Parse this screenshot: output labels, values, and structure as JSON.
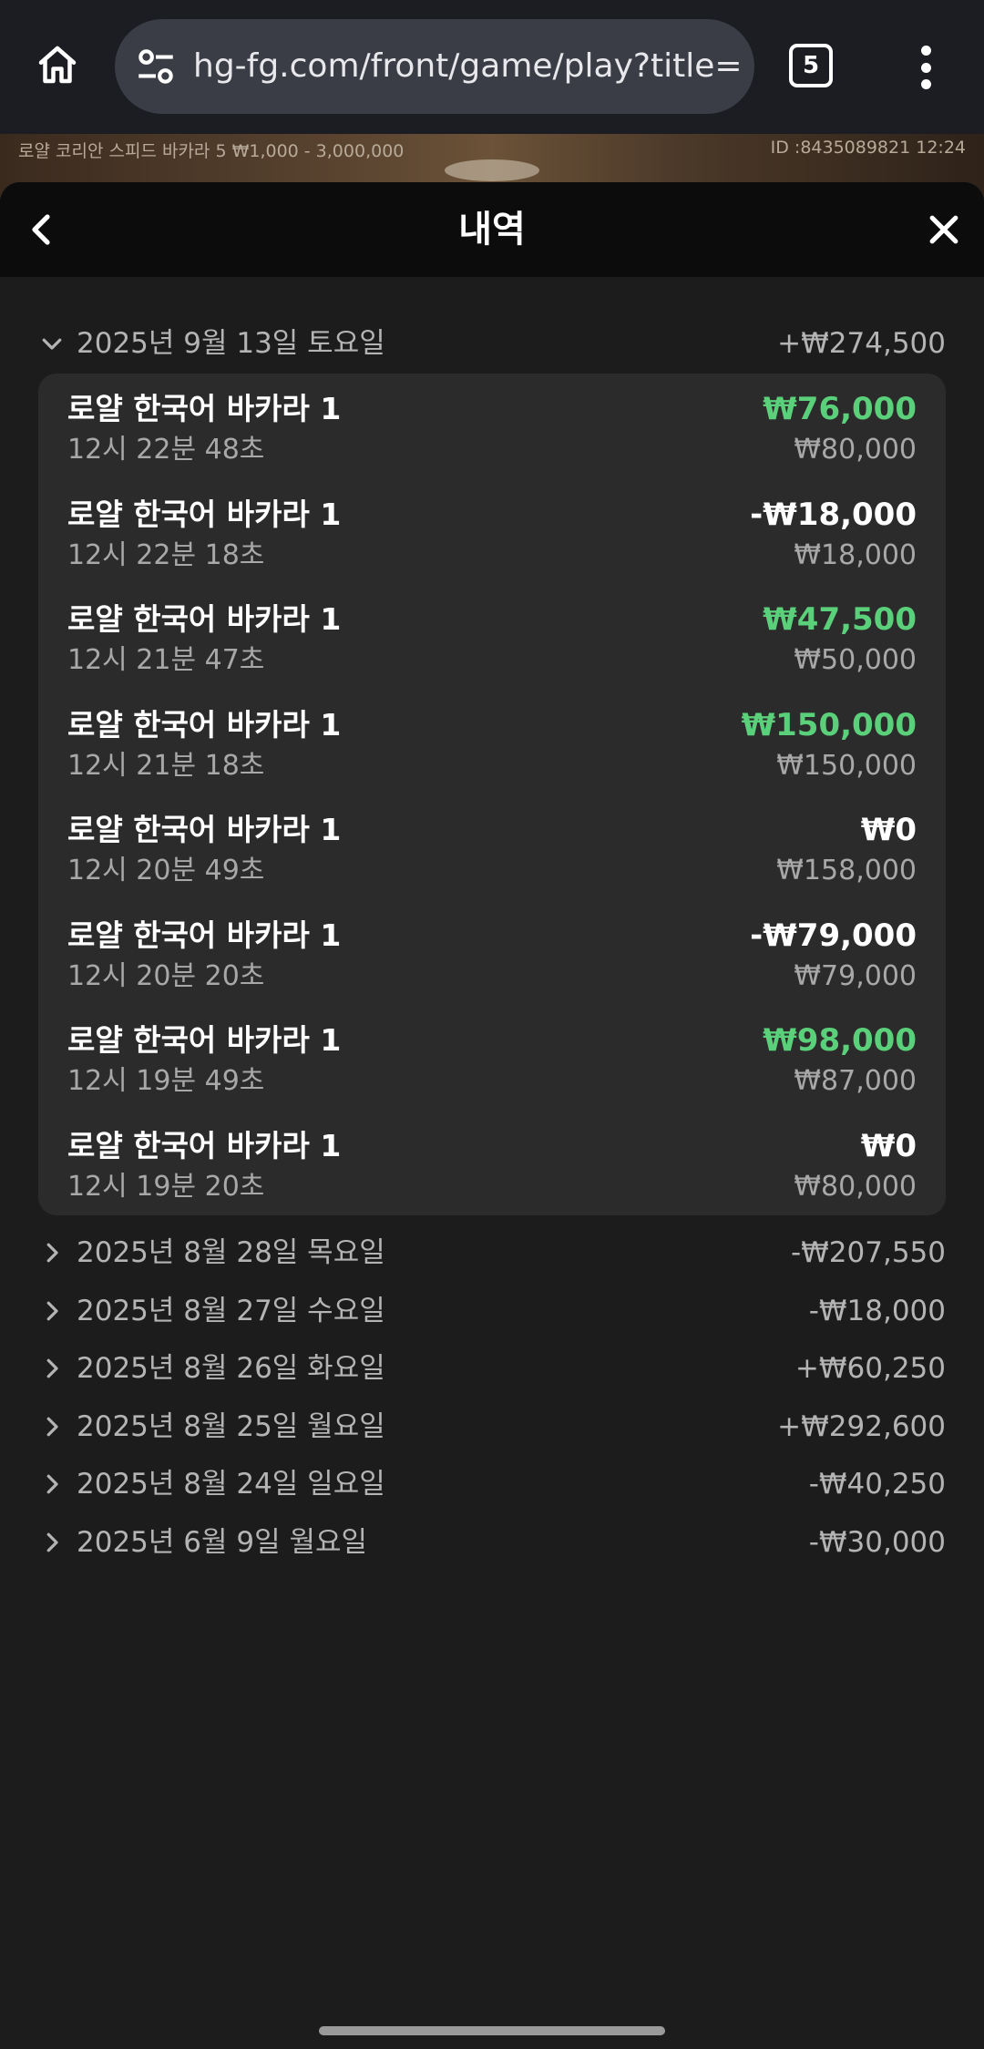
{
  "browser": {
    "url": "hg-fg.com/front/game/play?title=프",
    "tab_count": "5"
  },
  "game_strip": {
    "table_info": "로얄 코리안 스피드 바카라 5 ₩1,000 - 3,000,000",
    "round_info": "ID :8435089821 12:24"
  },
  "panel": {
    "title": "내역"
  },
  "expanded_day": {
    "date": "2025년 9월 13일 토요일",
    "total": "+₩274,500",
    "bets": [
      {
        "game": "로얄 한국어 바카라 1",
        "time": "12시 22분 48초",
        "result": "₩76,000",
        "stake": "₩80,000",
        "win": true
      },
      {
        "game": "로얄 한국어 바카라 1",
        "time": "12시 22분 18초",
        "result": "-₩18,000",
        "stake": "₩18,000",
        "win": false
      },
      {
        "game": "로얄 한국어 바카라 1",
        "time": "12시 21분 47초",
        "result": "₩47,500",
        "stake": "₩50,000",
        "win": true
      },
      {
        "game": "로얄 한국어 바카라 1",
        "time": "12시 21분 18초",
        "result": "₩150,000",
        "stake": "₩150,000",
        "win": true
      },
      {
        "game": "로얄 한국어 바카라 1",
        "time": "12시 20분 49초",
        "result": "₩0",
        "stake": "₩158,000",
        "win": false
      },
      {
        "game": "로얄 한국어 바카라 1",
        "time": "12시 20분 20초",
        "result": "-₩79,000",
        "stake": "₩79,000",
        "win": false
      },
      {
        "game": "로얄 한국어 바카라 1",
        "time": "12시 19분 49초",
        "result": "₩98,000",
        "stake": "₩87,000",
        "win": true
      },
      {
        "game": "로얄 한국어 바카라 1",
        "time": "12시 19분 20초",
        "result": "₩0",
        "stake": "₩80,000",
        "win": false
      }
    ]
  },
  "collapsed_days": [
    {
      "date": "2025년 8월 28일 목요일",
      "total": "-₩207,550"
    },
    {
      "date": "2025년 8월 27일 수요일",
      "total": "-₩18,000"
    },
    {
      "date": "2025년 8월 26일 화요일",
      "total": "+₩60,250"
    },
    {
      "date": "2025년 8월 25일 월요일",
      "total": "+₩292,600"
    },
    {
      "date": "2025년 8월 24일 일요일",
      "total": "-₩40,250"
    },
    {
      "date": "2025년 6월 9일 월요일",
      "total": "-₩30,000"
    }
  ],
  "colors": {
    "win": "#5bd07a",
    "card": "#2b2b2b",
    "background": "#1c1c1c"
  }
}
